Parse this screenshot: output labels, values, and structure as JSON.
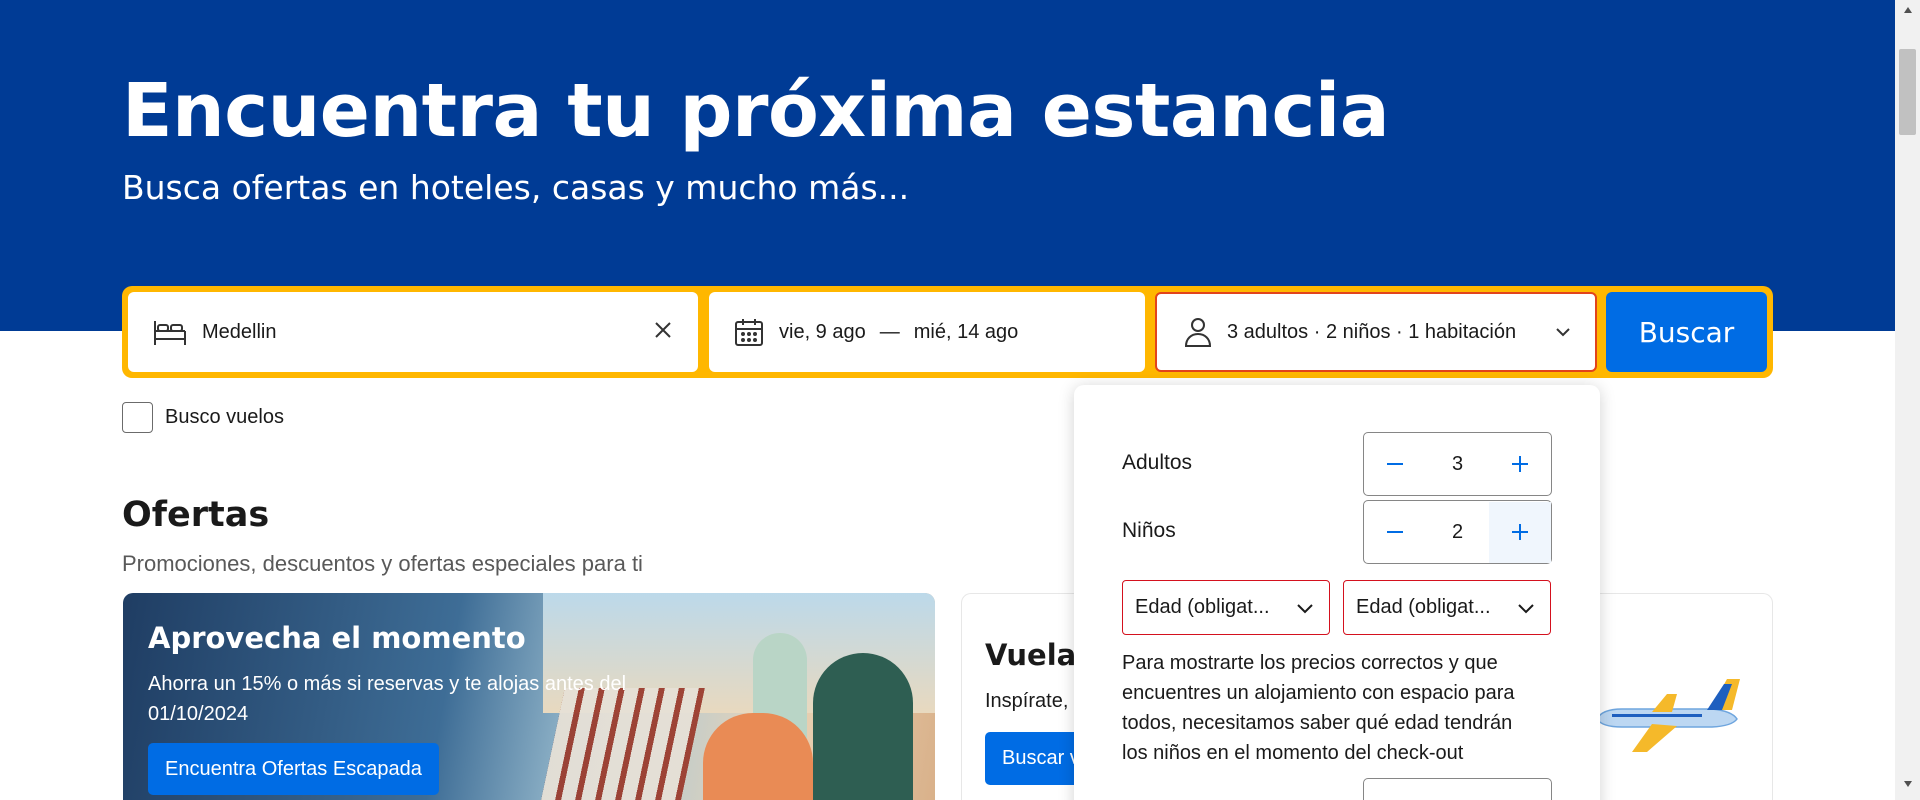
{
  "hero": {
    "title": "Encuentra tu próxima estancia",
    "subtitle": "Busca ofertas en hoteles, casas y mucho más..."
  },
  "search": {
    "destination": "Medellin",
    "checkin": "vie, 9 ago",
    "separator": "—",
    "checkout": "mié, 14 ago",
    "guests": "3 adultos · 2 niños · 1 habitación",
    "button": "Buscar"
  },
  "flights_checkbox": {
    "label": "Busco vuelos",
    "checked": false
  },
  "offers": {
    "title": "Ofertas",
    "subtitle": "Promociones, descuentos y ofertas especiales para ti",
    "card1": {
      "title": "Aprovecha el momento",
      "text": "Ahorra un 15% o más si reservas y te alojas antes del 01/10/2024",
      "button": "Encuentra Ofertas Escapada"
    },
    "card2": {
      "title": "Vuela",
      "text": "Inspírate,",
      "button": "Buscar v"
    }
  },
  "guest_popup": {
    "adults_label": "Adultos",
    "adults_value": "3",
    "children_label": "Niños",
    "children_value": "2",
    "age_select_1": "Edad (obligat...",
    "age_select_2": "Edad (obligat...",
    "note": "Para mostrarte los precios correctos y que encuentres un alojamiento con espacio para todos, necesitamos saber qué edad tendrán los niños en el momento del check-out"
  },
  "colors": {
    "brand_blue": "#003b95",
    "action_blue": "#006ce4",
    "search_border": "#ffb700",
    "error_red": "#d4111e"
  }
}
